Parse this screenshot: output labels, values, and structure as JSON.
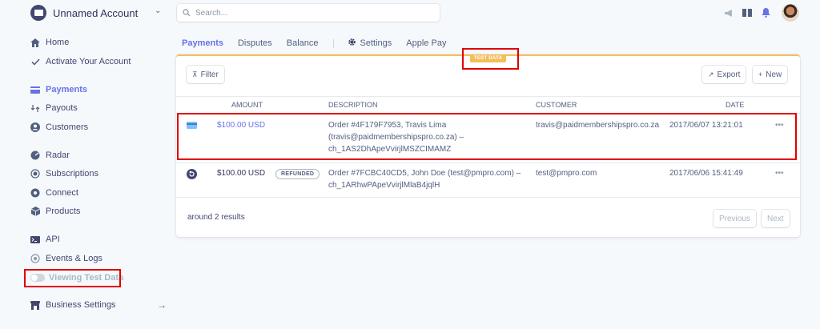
{
  "header": {
    "account_name": "Unnamed Account",
    "search_placeholder": "Search..."
  },
  "sidebar": {
    "items": [
      {
        "label": "Home",
        "icon": "home-icon"
      },
      {
        "label": "Activate Your Account",
        "icon": "check-icon"
      },
      {
        "label": "Payments",
        "icon": "payments-icon",
        "active": true
      },
      {
        "label": "Payouts",
        "icon": "payouts-icon"
      },
      {
        "label": "Customers",
        "icon": "customers-icon"
      },
      {
        "label": "Radar",
        "icon": "radar-icon"
      },
      {
        "label": "Subscriptions",
        "icon": "subscriptions-icon"
      },
      {
        "label": "Connect",
        "icon": "connect-icon"
      },
      {
        "label": "Products",
        "icon": "products-icon"
      },
      {
        "label": "API",
        "icon": "api-icon"
      },
      {
        "label": "Events & Logs",
        "icon": "events-icon"
      },
      {
        "label": "Viewing Test Data",
        "icon": "toggle-icon"
      },
      {
        "label": "Business Settings",
        "icon": "business-icon"
      }
    ]
  },
  "tabs": {
    "payments": "Payments",
    "disputes": "Disputes",
    "balance": "Balance",
    "settings": "Settings",
    "apple_pay": "Apple Pay"
  },
  "card": {
    "test_badge": "TEST DATA",
    "filter_label": "Filter",
    "export_label": "Export",
    "new_label": "New",
    "columns": {
      "amount": "AMOUNT",
      "description": "DESCRIPTION",
      "customer": "CUSTOMER",
      "date": "DATE"
    },
    "rows": [
      {
        "amount": "$100.00 USD",
        "description_lines": [
          "Order #4F179F7953, Travis Lima",
          "(travis@paidmembershipspro.co.za) –",
          "ch_1AS2DhApeVvirjlMSZCIMAMZ"
        ],
        "customer": "travis@paidmembershipspro.co.za",
        "date": "2017/06/07 13:21:01",
        "status": ""
      },
      {
        "amount": "$100.00 USD",
        "description_lines": [
          "Order #7FCBC40CD5, John Doe (test@pmpro.com) –",
          "ch_1ARhwPApeVvirjlMlaB4jqlH"
        ],
        "customer": "test@pmpro.com",
        "date": "2017/06/06 15:41:49",
        "status": "REFUNDED"
      }
    ],
    "results_text": "around 2 results",
    "previous_label": "Previous",
    "next_label": "Next",
    "more_label": "•••"
  },
  "colors": {
    "accent": "#6772e5",
    "test_data": "#f5be58",
    "highlight": "#e00000"
  }
}
